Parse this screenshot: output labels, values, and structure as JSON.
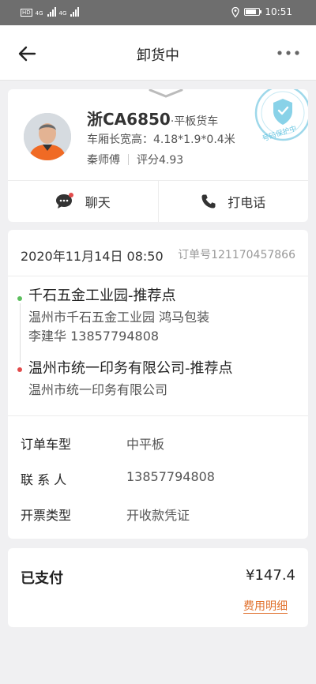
{
  "status_bar": {
    "time": "10:51",
    "network_1": "4G",
    "network_2": "4G",
    "sim_label": "HD"
  },
  "nav": {
    "title": "卸货中"
  },
  "driver": {
    "plate": "浙CA6850",
    "vehicle_type": "·平板货车",
    "dimensions": "车厢长宽高：4.18*1.9*0.4米",
    "name": "秦师傅",
    "rating": "评分4.93",
    "seal_text": "号码保护中"
  },
  "actions": {
    "chat": "聊天",
    "call": "打电话"
  },
  "order": {
    "datetime": "2020年11月14日 08:50",
    "order_no": "订单号121170457866",
    "pickup": {
      "name": "千石五金工业园-推荐点",
      "address": "温州市千石五金工业园 鸿马包装",
      "contact": "李建华 13857794808"
    },
    "dropoff": {
      "name": "温州市统一印务有限公司-推荐点",
      "address": "温州市统一印务有限公司"
    },
    "details": [
      {
        "label": "订单车型",
        "value": "中平板"
      },
      {
        "label": "联 系 人",
        "value": "13857794808"
      },
      {
        "label": "开票类型",
        "value": "开收款凭证"
      }
    ]
  },
  "payment": {
    "status": "已支付",
    "amount": "¥147.4",
    "fee_link": "费用明细"
  },
  "colors": {
    "accent_orange": "#e0702c",
    "dot_green": "#5cbf5e",
    "dot_red": "#e24b4b",
    "seal_blue": "#4ab8d8"
  }
}
